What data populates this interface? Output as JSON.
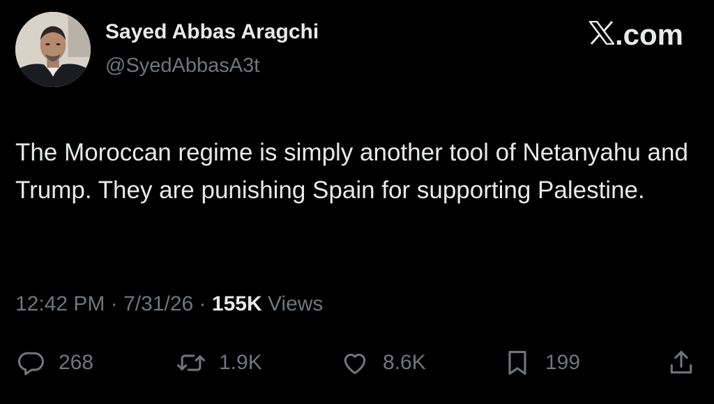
{
  "author": {
    "display_name": "Sayed Abbas Aragchi",
    "handle": "@SyedAbbasA3t"
  },
  "brand": {
    "label": ".com",
    "icon": "x-logo-icon"
  },
  "tweet": {
    "text": "The Moroccan regime is simply another tool of Netanyahu and Trump. They are punishing Spain for supporting Palestine."
  },
  "meta": {
    "time": "12:42 PM",
    "separator": "·",
    "date": "7/31/26",
    "views_count": "155K",
    "views_label": "Views"
  },
  "actions": {
    "replies": "268",
    "reposts": "1.9K",
    "likes": "8.6K",
    "bookmarks": "199"
  },
  "colors": {
    "background": "#000000",
    "primary_text": "#e7e9ea",
    "secondary_text": "#71767b"
  }
}
